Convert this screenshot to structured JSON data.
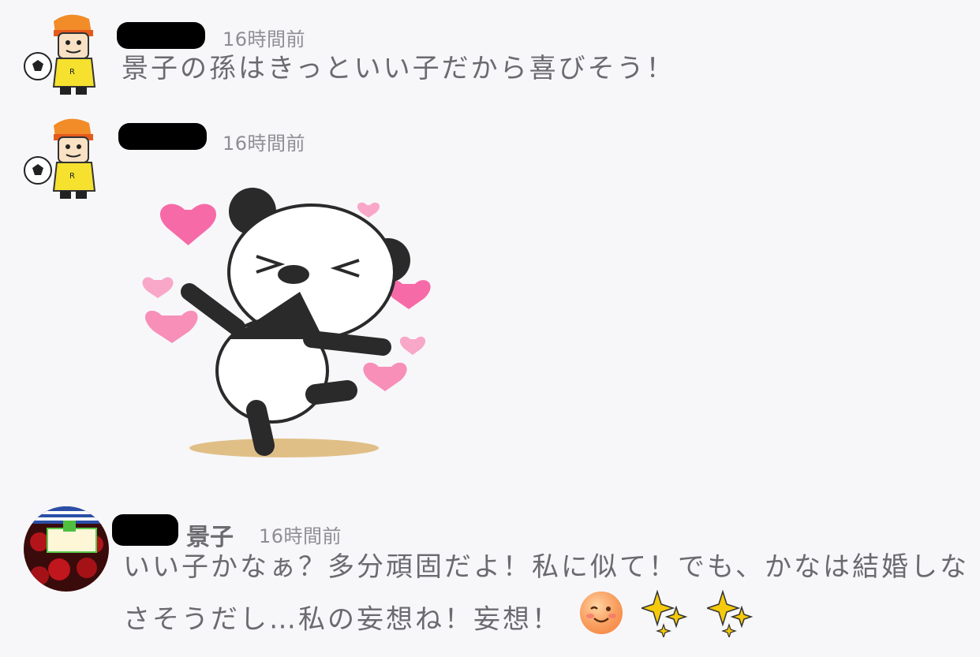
{
  "messages": [
    {
      "time": "16時間前",
      "text": "景子の孫はきっといい子だから喜びそう！",
      "avatar_icon": "soccer-player-avatar"
    },
    {
      "time": "16時間前",
      "sticker_icon": "panda-hearts-sticker",
      "avatar_icon": "soccer-player-avatar"
    },
    {
      "sender": "景子",
      "time": "16時間前",
      "line1": "いい子かなぁ？多分頑固だよ！私に似て！でも、かなは結婚しな",
      "line2": "さそうだし…私の妄想ね！妄想！",
      "emojis": [
        "winking-face-icon",
        "sparkles-icon",
        "sparkles-icon"
      ],
      "avatar_icon": "red-roses-avatar"
    }
  ]
}
